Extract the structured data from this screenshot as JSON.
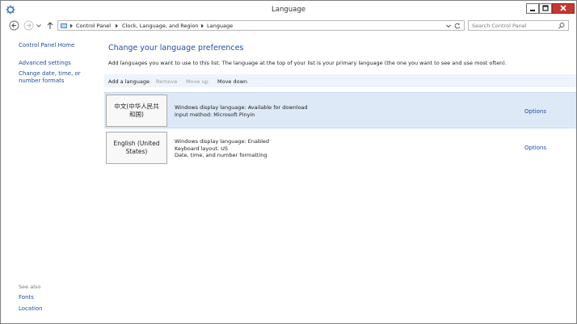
{
  "window": {
    "title": "Language",
    "controls": {
      "minimize": "minimize",
      "maximize": "maximize",
      "close": "close"
    }
  },
  "address_bar": {
    "breadcrumbs": [
      "Control Panel",
      "Clock, Language, and Region",
      "Language"
    ]
  },
  "search": {
    "placeholder": "Search Control Panel"
  },
  "left_pane": {
    "home": "Control Panel Home",
    "links": [
      "Advanced settings",
      "Change date, time, or number formats"
    ],
    "see_also_label": "See also",
    "see_also": [
      "Fonts",
      "Location"
    ]
  },
  "main": {
    "heading": "Change your language preferences",
    "description": "Add languages you want to use to this list. The language at the top of your list is your primary language (the one you want to see and use most often).",
    "toolbar": {
      "add": "Add a language",
      "remove": "Remove",
      "move_up": "Move up",
      "move_down": "Move down"
    },
    "languages": [
      {
        "name": "中文(中华人民共和国)",
        "details": [
          "Windows display language: Available for download",
          "Input method: Microsoft Pinyin"
        ],
        "options": "Options"
      },
      {
        "name": "English (United States)",
        "details": [
          "Windows display language: Enabled",
          "Keyboard layout: US",
          "Date, time, and number formatting"
        ],
        "options": "Options"
      }
    ]
  },
  "colors": {
    "link": "#1f4ea5",
    "selected_row": "#dde9f7",
    "toolbar": "#eef4fb",
    "close_button": "#c7372f",
    "disabled_text": "#9b9b9b"
  }
}
